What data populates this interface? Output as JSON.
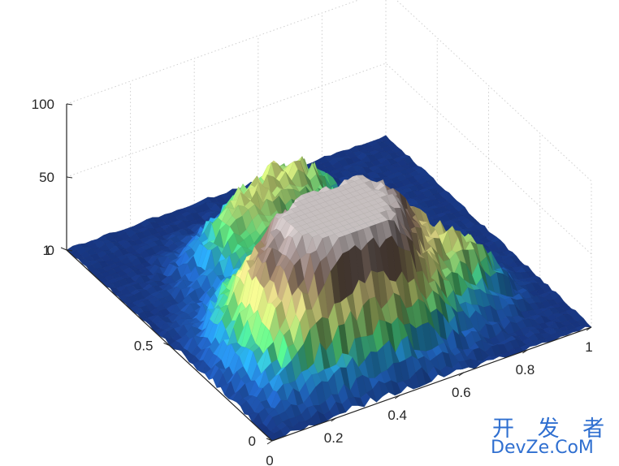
{
  "chart_data": {
    "type": "surface",
    "title": "",
    "xlabel": "",
    "ylabel": "",
    "zlabel": "",
    "x_ticks": [
      {
        "value": 0,
        "label": "0"
      },
      {
        "value": 0.2,
        "label": "0.2"
      },
      {
        "value": 0.4,
        "label": "0.4"
      },
      {
        "value": 0.6,
        "label": "0.6"
      },
      {
        "value": 0.8,
        "label": "0.8"
      },
      {
        "value": 1,
        "label": "1"
      }
    ],
    "y_ticks": [
      {
        "value": 0,
        "label": "0"
      },
      {
        "value": 0.5,
        "label": "0.5"
      },
      {
        "value": 1,
        "label": "1"
      }
    ],
    "z_ticks": [
      {
        "value": 0,
        "label": "0"
      },
      {
        "value": 50,
        "label": "50"
      },
      {
        "value": 100,
        "label": "100"
      }
    ],
    "xlim": [
      0,
      1
    ],
    "ylim": [
      0,
      1
    ],
    "zlim": [
      0,
      100
    ],
    "colormap": "terrain",
    "colors": {
      "deep": "#1a3a8c",
      "mid_blue": "#2f8fe0",
      "green": "#4fe07a",
      "yellow": "#e8e48a",
      "brown": "#8a7060",
      "peak": "#f0ecec"
    },
    "grid": true,
    "data_summary": {
      "main_peak": {
        "x": 0.3,
        "y": 0.3,
        "z": 85
      },
      "secondary_ridge": {
        "x": 0.6,
        "y": 0.4,
        "z": 70
      },
      "foothills": {
        "x": 0.55,
        "y": 0.75,
        "z": 45
      },
      "min_z": 0,
      "max_z": 95
    }
  },
  "watermark": {
    "line1": "开 发 者",
    "line2": "DevZe.CoM"
  }
}
